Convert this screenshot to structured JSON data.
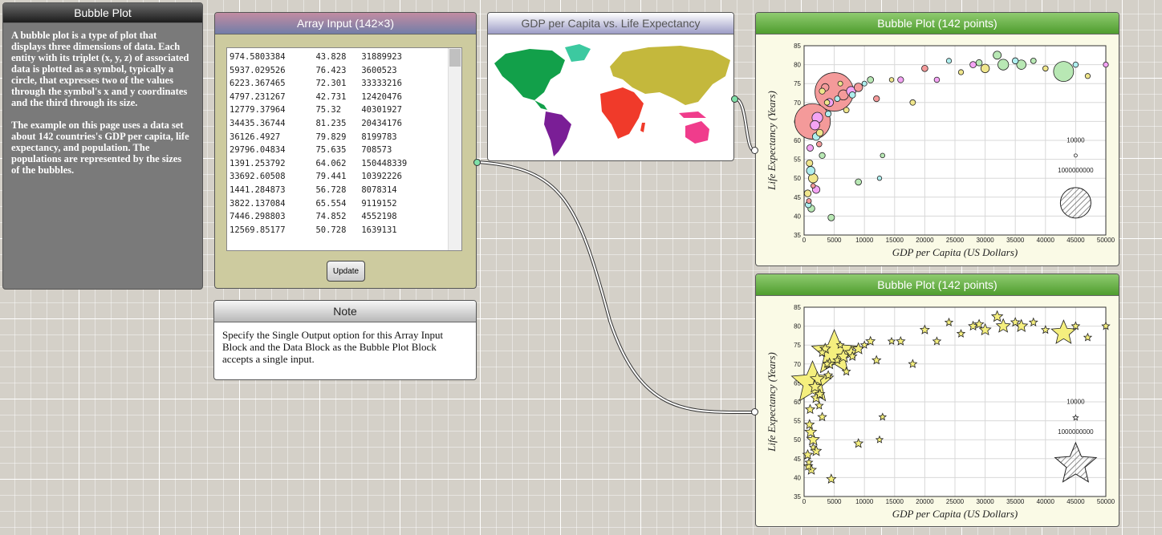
{
  "description": {
    "title": "Bubble Plot",
    "para1": "A bubble plot is a type of plot that displays three dimensions of data. Each entity with its triplet (x, y, z) of associated data is plotted as a symbol, typically a circle, that expresses two of the values through the symbol's x and y coordinates and the third through its size.",
    "para2": "The example on this page uses a data set about 142 countries's GDP per capita, life expectancy, and population. The populations are represented by the sizes of the bubbles."
  },
  "array_input": {
    "title": "Array Input (142×3)",
    "rows": [
      [
        "974.5803384",
        "43.828",
        "31889923"
      ],
      [
        "5937.029526",
        "76.423",
        "3600523"
      ],
      [
        "6223.367465",
        "72.301",
        "33333216"
      ],
      [
        "4797.231267",
        "42.731",
        "12420476"
      ],
      [
        "12779.37964",
        "75.32",
        "40301927"
      ],
      [
        "34435.36744",
        "81.235",
        "20434176"
      ],
      [
        "36126.4927",
        "79.829",
        "8199783"
      ],
      [
        "29796.04834",
        "75.635",
        "708573"
      ],
      [
        "1391.253792",
        "64.062",
        "150448339"
      ],
      [
        "33692.60508",
        "79.441",
        "10392226"
      ],
      [
        "1441.284873",
        "56.728",
        "8078314"
      ],
      [
        "3822.137084",
        "65.554",
        "9119152"
      ],
      [
        "7446.298803",
        "74.852",
        "4552198"
      ],
      [
        "12569.85177",
        "50.728",
        "1639131"
      ]
    ],
    "update_label": "Update"
  },
  "note": {
    "title": "Note",
    "text": "Specify the Single Output option for this Array Input Block and the Data Block as the Bubble Plot Block accepts a single input."
  },
  "map": {
    "title": "GDP per Capita vs. Life Expectancy",
    "colors": {
      "north_america": "#3cc9a0",
      "south_america": "#7a1e96",
      "europe_asia": "#c4b83c",
      "africa": "#f03a2a",
      "oceania": "#f03c8c",
      "greenland": "#12a04a"
    }
  },
  "chart_data": [
    {
      "type": "scatter",
      "title": "Bubble Plot (142 points)",
      "marker": "circle",
      "xlabel": "GDP per Capita (US Dollars)",
      "ylabel": "Life Expectancy (Years)",
      "xlim": [
        0,
        50000
      ],
      "ylim": [
        35,
        85
      ],
      "xticks": [
        0,
        5000,
        10000,
        15000,
        20000,
        25000,
        30000,
        35000,
        40000,
        45000,
        50000
      ],
      "yticks": [
        35,
        40,
        45,
        50,
        55,
        60,
        65,
        70,
        75,
        80,
        85
      ],
      "grid": true,
      "legend": {
        "position": "bottom-right",
        "small_label": "10000",
        "large_label": "1000000000"
      },
      "series": [
        {
          "name": "",
          "color": "#f49a9a",
          "points": [
            [
              5000,
              72.8,
              1320000000
            ],
            [
              1400,
              65,
              1110000000
            ],
            [
              1500,
              48,
              2000000
            ],
            [
              800,
              44,
              3000000
            ],
            [
              3500,
              74,
              20000000
            ],
            [
              6500,
              72,
              50000000
            ],
            [
              2500,
              59,
              5000000
            ],
            [
              9000,
              74,
              30000000
            ],
            [
              12000,
              71,
              8000000
            ],
            [
              20000,
              79,
              10000000
            ]
          ]
        },
        {
          "name": "",
          "color": "#f4a4f4",
          "points": [
            [
              1000,
              58,
              12000000
            ],
            [
              1800,
              64,
              40000000
            ],
            [
              4200,
              70,
              25000000
            ],
            [
              7800,
              73,
              40000000
            ],
            [
              2000,
              47,
              20000000
            ],
            [
              22000,
              76,
              5000000
            ],
            [
              16000,
              76,
              8000000
            ],
            [
              28000,
              80,
              10000000
            ],
            [
              50000,
              80,
              4000000
            ],
            [
              2200,
              66,
              60000000
            ]
          ]
        },
        {
          "name": "",
          "color": "#b8e8b4",
          "points": [
            [
              43000,
              78.2,
              301000000
            ],
            [
              32000,
              82.5,
              25000000
            ],
            [
              33000,
              80,
              60000000
            ],
            [
              29000,
              80.5,
              10000000
            ],
            [
              36000,
              80,
              40000000
            ],
            [
              11000,
              76,
              10000000
            ],
            [
              13000,
              56,
              2000000
            ],
            [
              9000,
              49,
              10000000
            ],
            [
              3000,
              56,
              8000000
            ],
            [
              4500,
              39.6,
              12000000
            ],
            [
              38000,
              81,
              6000000
            ],
            [
              1200,
              42,
              15000000
            ]
          ]
        },
        {
          "name": "",
          "color": "#f0e68c",
          "points": [
            [
              600,
              46,
              14000000
            ],
            [
              900,
              54,
              12000000
            ],
            [
              2600,
              62,
              15000000
            ],
            [
              3800,
              70,
              5000000
            ],
            [
              14500,
              76,
              2000000
            ],
            [
              18000,
              70,
              6000000
            ],
            [
              26000,
              78,
              4000000
            ],
            [
              30000,
              79,
              30000000
            ],
            [
              40000,
              79,
              5000000
            ],
            [
              47000,
              77,
              4000000
            ],
            [
              6000,
              75,
              3000000
            ],
            [
              3000,
              73,
              8000000
            ],
            [
              1500,
              50,
              40000000
            ],
            [
              7000,
              68,
              6000000
            ]
          ]
        },
        {
          "name": "",
          "color": "#aeeeee",
          "points": [
            [
              700,
              43,
              9000000
            ],
            [
              1100,
              52,
              30000000
            ],
            [
              2000,
              61,
              20000000
            ],
            [
              4000,
              67,
              8000000
            ],
            [
              8000,
              72,
              10000000
            ],
            [
              10000,
              75,
              3000000
            ],
            [
              24000,
              81,
              4000000
            ],
            [
              35000,
              81,
              9000000
            ],
            [
              45000,
              80,
              5000000
            ],
            [
              5500,
              71,
              6000000
            ],
            [
              12500,
              50,
              1600000
            ]
          ]
        }
      ]
    },
    {
      "type": "scatter",
      "title": "Bubble Plot (142 points)",
      "marker": "star",
      "xlabel": "GDP per Capita (US Dollars)",
      "ylabel": "Life Expectancy (Years)",
      "xlim": [
        0,
        50000
      ],
      "ylim": [
        35,
        85
      ],
      "xticks": [
        0,
        5000,
        10000,
        15000,
        20000,
        25000,
        30000,
        35000,
        40000,
        45000,
        50000
      ],
      "yticks": [
        35,
        40,
        45,
        50,
        55,
        60,
        65,
        70,
        75,
        80,
        85
      ],
      "grid": true,
      "legend": {
        "position": "bottom-right",
        "small_label": "10000",
        "large_label": "1000000000"
      },
      "series": [
        {
          "name": "",
          "color": "#f5ef7e",
          "points": [
            [
              5000,
              72.8,
              1320000000
            ],
            [
              1400,
              65,
              1110000000
            ],
            [
              43000,
              78.2,
              301000000
            ],
            [
              1500,
              48,
              2000000
            ],
            [
              800,
              44,
              3000000
            ],
            [
              3500,
              74,
              20000000
            ],
            [
              6500,
              72,
              50000000
            ],
            [
              2500,
              59,
              5000000
            ],
            [
              9000,
              74,
              30000000
            ],
            [
              12000,
              71,
              8000000
            ],
            [
              20000,
              79,
              10000000
            ],
            [
              1000,
              58,
              12000000
            ],
            [
              1800,
              64,
              40000000
            ],
            [
              4200,
              70,
              25000000
            ],
            [
              7800,
              73,
              40000000
            ],
            [
              2000,
              47,
              20000000
            ],
            [
              22000,
              76,
              5000000
            ],
            [
              16000,
              76,
              8000000
            ],
            [
              28000,
              80,
              10000000
            ],
            [
              50000,
              80,
              4000000
            ],
            [
              2200,
              66,
              60000000
            ],
            [
              32000,
              82.5,
              25000000
            ],
            [
              33000,
              80,
              60000000
            ],
            [
              29000,
              80.5,
              10000000
            ],
            [
              36000,
              80,
              40000000
            ],
            [
              11000,
              76,
              10000000
            ],
            [
              13000,
              56,
              2000000
            ],
            [
              9000,
              49,
              10000000
            ],
            [
              3000,
              56,
              8000000
            ],
            [
              4500,
              39.6,
              12000000
            ],
            [
              38000,
              81,
              6000000
            ],
            [
              1200,
              42,
              15000000
            ],
            [
              600,
              46,
              14000000
            ],
            [
              900,
              54,
              12000000
            ],
            [
              2600,
              62,
              15000000
            ],
            [
              3800,
              70,
              5000000
            ],
            [
              14500,
              76,
              2000000
            ],
            [
              18000,
              70,
              6000000
            ],
            [
              26000,
              78,
              4000000
            ],
            [
              30000,
              79,
              30000000
            ],
            [
              40000,
              79,
              5000000
            ],
            [
              47000,
              77,
              4000000
            ],
            [
              6000,
              75,
              3000000
            ],
            [
              3000,
              73,
              8000000
            ],
            [
              1500,
              50,
              40000000
            ],
            [
              7000,
              68,
              6000000
            ],
            [
              700,
              43,
              9000000
            ],
            [
              1100,
              52,
              30000000
            ],
            [
              2000,
              61,
              20000000
            ],
            [
              4000,
              67,
              8000000
            ],
            [
              8000,
              72,
              10000000
            ],
            [
              10000,
              75,
              3000000
            ],
            [
              24000,
              81,
              4000000
            ],
            [
              35000,
              81,
              9000000
            ],
            [
              45000,
              80,
              5000000
            ],
            [
              5500,
              71,
              6000000
            ],
            [
              12500,
              50,
              1600000
            ]
          ]
        }
      ]
    }
  ]
}
